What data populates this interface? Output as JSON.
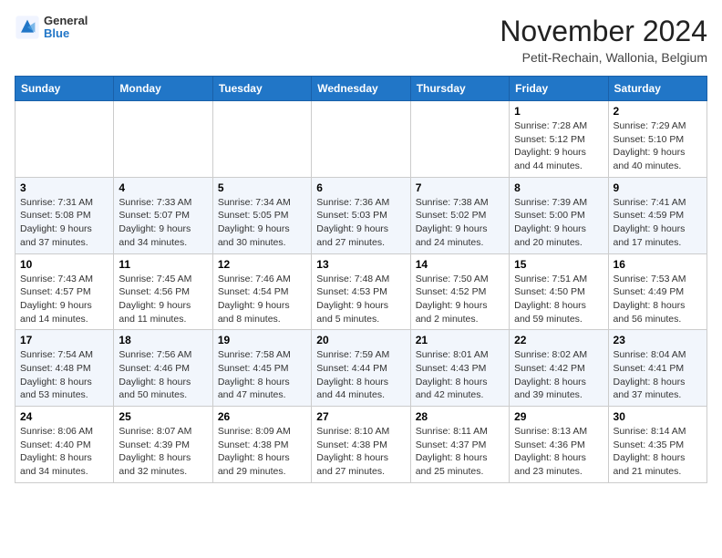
{
  "header": {
    "logo_general": "General",
    "logo_blue": "Blue",
    "month_title": "November 2024",
    "location": "Petit-Rechain, Wallonia, Belgium"
  },
  "weekdays": [
    "Sunday",
    "Monday",
    "Tuesday",
    "Wednesday",
    "Thursday",
    "Friday",
    "Saturday"
  ],
  "weeks": [
    [
      {
        "day": "",
        "info": ""
      },
      {
        "day": "",
        "info": ""
      },
      {
        "day": "",
        "info": ""
      },
      {
        "day": "",
        "info": ""
      },
      {
        "day": "",
        "info": ""
      },
      {
        "day": "1",
        "info": "Sunrise: 7:28 AM\nSunset: 5:12 PM\nDaylight: 9 hours and 44 minutes."
      },
      {
        "day": "2",
        "info": "Sunrise: 7:29 AM\nSunset: 5:10 PM\nDaylight: 9 hours and 40 minutes."
      }
    ],
    [
      {
        "day": "3",
        "info": "Sunrise: 7:31 AM\nSunset: 5:08 PM\nDaylight: 9 hours and 37 minutes."
      },
      {
        "day": "4",
        "info": "Sunrise: 7:33 AM\nSunset: 5:07 PM\nDaylight: 9 hours and 34 minutes."
      },
      {
        "day": "5",
        "info": "Sunrise: 7:34 AM\nSunset: 5:05 PM\nDaylight: 9 hours and 30 minutes."
      },
      {
        "day": "6",
        "info": "Sunrise: 7:36 AM\nSunset: 5:03 PM\nDaylight: 9 hours and 27 minutes."
      },
      {
        "day": "7",
        "info": "Sunrise: 7:38 AM\nSunset: 5:02 PM\nDaylight: 9 hours and 24 minutes."
      },
      {
        "day": "8",
        "info": "Sunrise: 7:39 AM\nSunset: 5:00 PM\nDaylight: 9 hours and 20 minutes."
      },
      {
        "day": "9",
        "info": "Sunrise: 7:41 AM\nSunset: 4:59 PM\nDaylight: 9 hours and 17 minutes."
      }
    ],
    [
      {
        "day": "10",
        "info": "Sunrise: 7:43 AM\nSunset: 4:57 PM\nDaylight: 9 hours and 14 minutes."
      },
      {
        "day": "11",
        "info": "Sunrise: 7:45 AM\nSunset: 4:56 PM\nDaylight: 9 hours and 11 minutes."
      },
      {
        "day": "12",
        "info": "Sunrise: 7:46 AM\nSunset: 4:54 PM\nDaylight: 9 hours and 8 minutes."
      },
      {
        "day": "13",
        "info": "Sunrise: 7:48 AM\nSunset: 4:53 PM\nDaylight: 9 hours and 5 minutes."
      },
      {
        "day": "14",
        "info": "Sunrise: 7:50 AM\nSunset: 4:52 PM\nDaylight: 9 hours and 2 minutes."
      },
      {
        "day": "15",
        "info": "Sunrise: 7:51 AM\nSunset: 4:50 PM\nDaylight: 8 hours and 59 minutes."
      },
      {
        "day": "16",
        "info": "Sunrise: 7:53 AM\nSunset: 4:49 PM\nDaylight: 8 hours and 56 minutes."
      }
    ],
    [
      {
        "day": "17",
        "info": "Sunrise: 7:54 AM\nSunset: 4:48 PM\nDaylight: 8 hours and 53 minutes."
      },
      {
        "day": "18",
        "info": "Sunrise: 7:56 AM\nSunset: 4:46 PM\nDaylight: 8 hours and 50 minutes."
      },
      {
        "day": "19",
        "info": "Sunrise: 7:58 AM\nSunset: 4:45 PM\nDaylight: 8 hours and 47 minutes."
      },
      {
        "day": "20",
        "info": "Sunrise: 7:59 AM\nSunset: 4:44 PM\nDaylight: 8 hours and 44 minutes."
      },
      {
        "day": "21",
        "info": "Sunrise: 8:01 AM\nSunset: 4:43 PM\nDaylight: 8 hours and 42 minutes."
      },
      {
        "day": "22",
        "info": "Sunrise: 8:02 AM\nSunset: 4:42 PM\nDaylight: 8 hours and 39 minutes."
      },
      {
        "day": "23",
        "info": "Sunrise: 8:04 AM\nSunset: 4:41 PM\nDaylight: 8 hours and 37 minutes."
      }
    ],
    [
      {
        "day": "24",
        "info": "Sunrise: 8:06 AM\nSunset: 4:40 PM\nDaylight: 8 hours and 34 minutes."
      },
      {
        "day": "25",
        "info": "Sunrise: 8:07 AM\nSunset: 4:39 PM\nDaylight: 8 hours and 32 minutes."
      },
      {
        "day": "26",
        "info": "Sunrise: 8:09 AM\nSunset: 4:38 PM\nDaylight: 8 hours and 29 minutes."
      },
      {
        "day": "27",
        "info": "Sunrise: 8:10 AM\nSunset: 4:38 PM\nDaylight: 8 hours and 27 minutes."
      },
      {
        "day": "28",
        "info": "Sunrise: 8:11 AM\nSunset: 4:37 PM\nDaylight: 8 hours and 25 minutes."
      },
      {
        "day": "29",
        "info": "Sunrise: 8:13 AM\nSunset: 4:36 PM\nDaylight: 8 hours and 23 minutes."
      },
      {
        "day": "30",
        "info": "Sunrise: 8:14 AM\nSunset: 4:35 PM\nDaylight: 8 hours and 21 minutes."
      }
    ]
  ]
}
